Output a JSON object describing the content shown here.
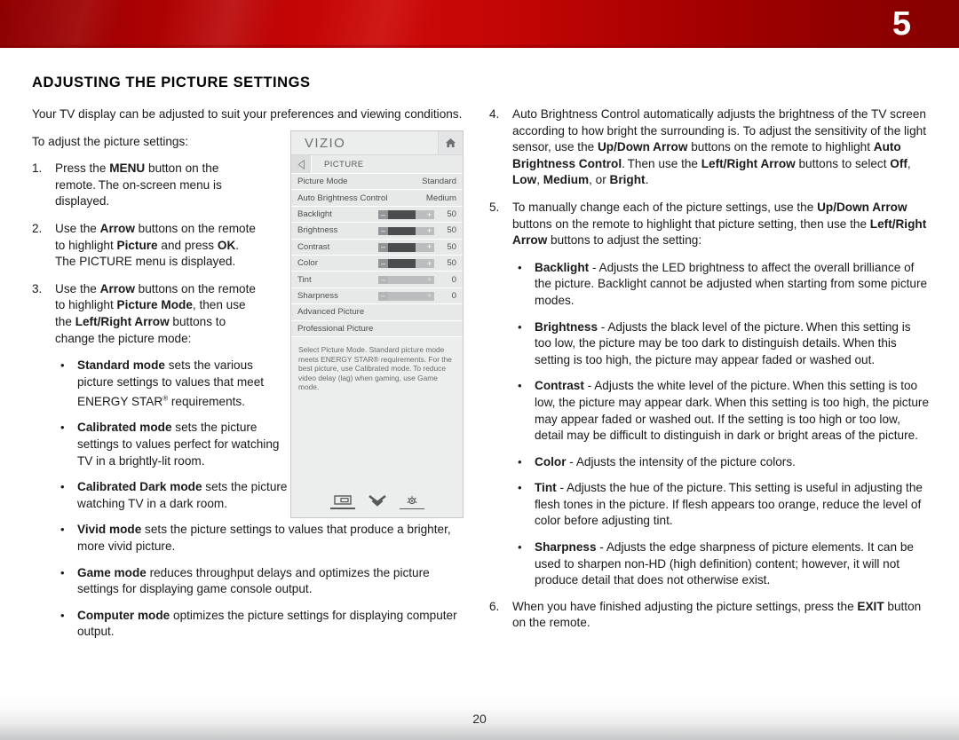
{
  "header": {
    "chapter_number": "5",
    "banner_color": "#c20505"
  },
  "footer": {
    "page_number": "20"
  },
  "page": {
    "heading": "ADJUSTING THE PICTURE SETTINGS",
    "intro_paragraph": "Your TV display can be adjusted to suit your preferences and viewing conditions.",
    "lead_in": "To adjust the picture settings:"
  },
  "steps_left": [
    {
      "num": "1.",
      "html": "Press the <b>MENU</b> button on the remote. The on-screen menu is displayed."
    },
    {
      "num": "2.",
      "html": "Use the <b>Arrow</b> buttons on the remote to highlight <b>Picture</b> and press <b>OK</b>. The PICTURE menu is displayed."
    },
    {
      "num": "3.",
      "html": "Use the <b>Arrow</b> buttons on the remote to highlight <b>Picture Mode</b>, then use the <b>Left/Right Arrow</b> buttons to change the picture mode:"
    }
  ],
  "modes_narrow": [
    {
      "html": "<b>Standard mode</b> sets the various picture settings to values that meet ENERGY STAR<sup>®</sup> requirements."
    },
    {
      "html": "<b>Calibrated mode</b> sets the picture settings to values perfect for watching TV in a brightly-lit room."
    }
  ],
  "modes_wide": [
    {
      "html": "<b>Calibrated Dark mode</b> sets the picture settings to values perfect for watching TV in a dark room."
    },
    {
      "html": "<b>Vivid mode</b> sets the picture settings to values that produce a brighter, more vivid picture."
    },
    {
      "html": "<b>Game mode</b> reduces throughput delays and optimizes the picture settings for displaying game console output."
    },
    {
      "html": "<b>Computer mode</b> optimizes the picture settings for displaying computer output."
    }
  ],
  "steps_right": [
    {
      "num": "4.",
      "html": "Auto Brightness Control automatically adjusts the brightness of the TV screen according to how bright the surrounding is. To adjust the sensitivity of the light sensor, use the <b>Up/Down Arrow</b> buttons on the remote to highlight <b>Auto Brightness Control</b>. Then use the <b>Left/Right Arrow</b> buttons to select <b>Off</b>, <b>Low</b>, <b>Medium</b>, or <b>Bright</b>."
    },
    {
      "num": "5.",
      "html": "To manually change each of the picture settings, use the <b>Up/Down Arrow</b> buttons on the remote to highlight that picture setting, then use the <b>Left/Right Arrow</b> buttons to adjust the setting:"
    }
  ],
  "settings_bullets": [
    {
      "html": "<b>Backlight</b> - Adjusts the LED brightness to affect the overall brilliance of the picture. Backlight cannot be adjusted when starting from some picture modes."
    },
    {
      "html": "<b>Brightness</b> - Adjusts the black level of the picture. When this setting is too low, the picture may be too dark to distinguish details. When this setting is too high, the picture may appear faded or washed out."
    },
    {
      "html": "<b>Contrast</b> - Adjusts the white level of the picture. When this setting is too low, the picture may appear dark. When this setting is too high, the picture may appear faded or washed out. If the setting is too high or too low, detail may be difficult to distinguish in dark or bright areas of the picture."
    },
    {
      "html": "<b>Color</b> - Adjusts the intensity of the picture colors."
    },
    {
      "html": "<b>Tint</b> - Adjusts the hue of the picture. This setting is useful in adjusting the flesh tones in the picture. If flesh appears too orange, reduce the level of color before adjusting tint."
    },
    {
      "html": "<b>Sharpness</b> - Adjusts the edge sharpness of picture elements. It can be used to sharpen non-HD (high definition) content; however, it will not produce detail that does not otherwise exist."
    }
  ],
  "final_step": {
    "num": "6.",
    "html": "When you have finished adjusting the picture settings, press the <b>EXIT</b> button on the remote."
  },
  "osd": {
    "brand": "VIZIO",
    "home_icon": "home-icon",
    "back_icon": "back-arrow-icon",
    "breadcrumb": "PICTURE",
    "rows": [
      {
        "label": "Picture Mode",
        "value": "Standard",
        "type": "value"
      },
      {
        "label": "Auto Brightness Control",
        "value": "Medium",
        "type": "value"
      },
      {
        "label": "Backlight",
        "value": "50",
        "type": "slider",
        "fill": 60
      },
      {
        "label": "Brightness",
        "value": "50",
        "type": "slider",
        "fill": 60
      },
      {
        "label": "Contrast",
        "value": "50",
        "type": "slider",
        "fill": 60
      },
      {
        "label": "Color",
        "value": "50",
        "type": "slider",
        "fill": 60
      },
      {
        "label": "Tint",
        "value": "0",
        "type": "slider",
        "fill": 0
      },
      {
        "label": "Sharpness",
        "value": "0",
        "type": "slider",
        "fill": 0
      },
      {
        "label": "Advanced Picture",
        "value": "",
        "type": "plain"
      },
      {
        "label": "Professional Picture",
        "value": "",
        "type": "plain"
      }
    ],
    "slider_minus": "–",
    "slider_plus": "+",
    "help_text": "Select Picture Mode. Standard picture mode meets ENERGY STAR® requirements. For the best picture, use Calibrated mode. To reduce video delay (lag) when gaming, use Game mode.",
    "footer_icons": [
      "display-icon",
      "chevron-double-down-icon",
      "gear-icon"
    ]
  }
}
